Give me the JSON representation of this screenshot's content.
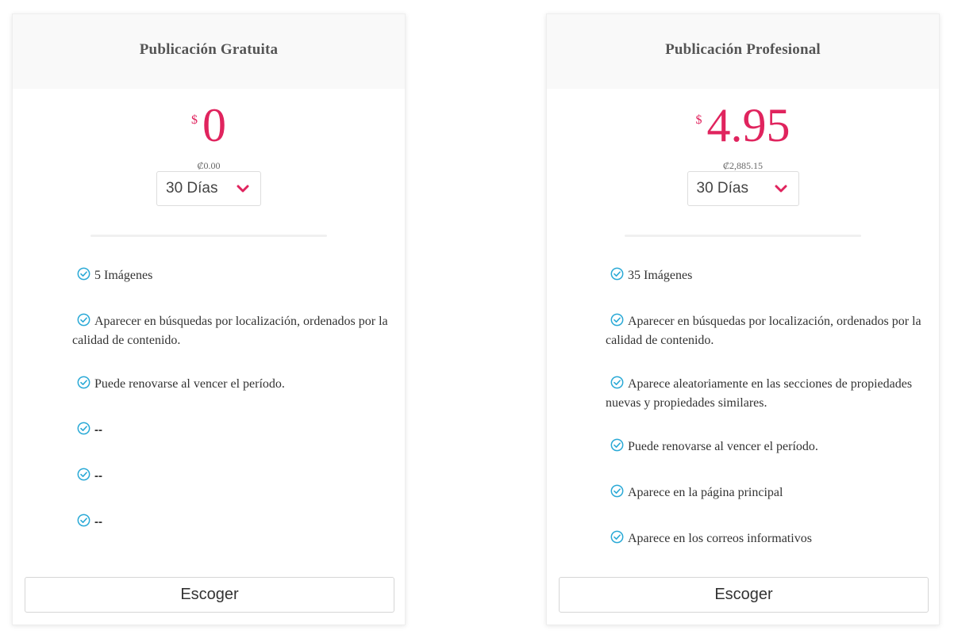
{
  "colors": {
    "accent": "#e0245e",
    "check": "#29a9d6",
    "header_bg": "#f9f9f9"
  },
  "plans": [
    {
      "title": "Publicación Gratuita",
      "currency_symbol": "$",
      "amount": "0",
      "local_price": "₡0.00",
      "duration": "30 Días",
      "features": [
        "5 Imágenes",
        "Aparecer en búsquedas por localización, ordenados por la calidad de contenido.",
        "Puede renovarse al vencer el período.",
        "--",
        "--",
        "--"
      ],
      "button_label": "Escoger"
    },
    {
      "title": "Publicación Profesional",
      "currency_symbol": "$",
      "amount": "4.95",
      "local_price": "₡2,885.15",
      "duration": "30 Días",
      "features": [
        "35 Imágenes",
        "Aparecer en búsquedas por localización, ordenados por la calidad de contenido.",
        "Aparece aleatoriamente en las secciones de propiedades nuevas y propiedades similares.",
        "Puede renovarse al vencer el período.",
        "Aparece en la página principal",
        "Aparece en los correos informativos"
      ],
      "button_label": "Escoger"
    }
  ],
  "icons": {
    "check": "check-circle-icon",
    "chevron": "chevron-down-icon"
  }
}
